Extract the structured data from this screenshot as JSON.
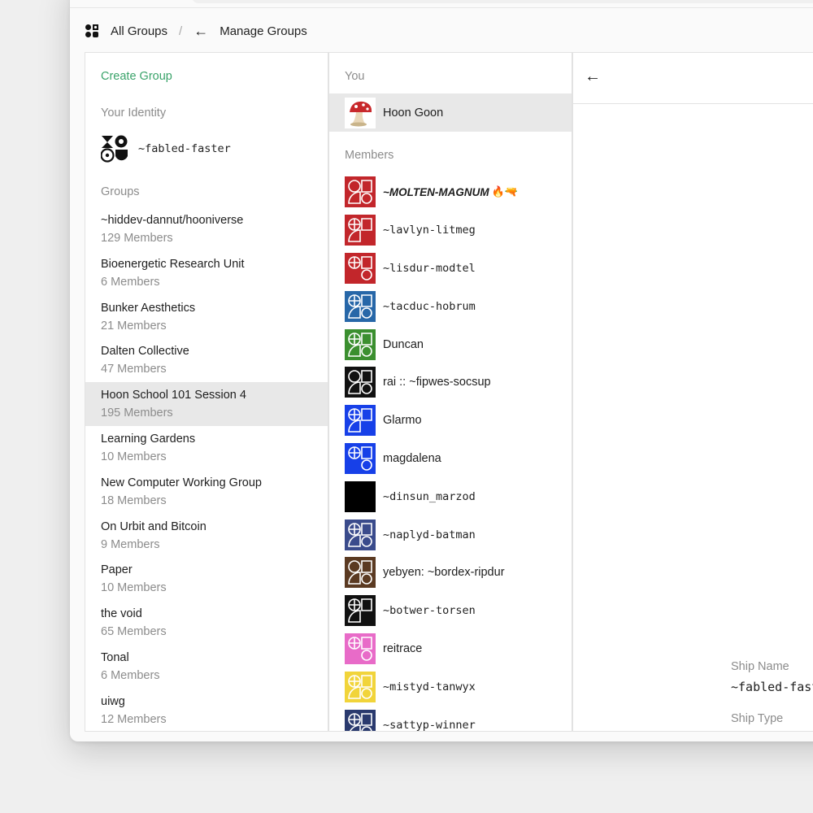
{
  "breadcrumb": {
    "root": "All Groups",
    "separator": "/",
    "back": "←",
    "current": "Manage Groups"
  },
  "sidebar": {
    "create_group": "Create Group",
    "identity_label": "Your Identity",
    "identity_ship": "~fabled-faster",
    "groups_label": "Groups",
    "groups": [
      {
        "name": "~hiddev-dannut/hooniverse",
        "members": "129 Members"
      },
      {
        "name": "Bioenergetic Research Unit",
        "members": "6 Members"
      },
      {
        "name": "Bunker Aesthetics",
        "members": "21 Members"
      },
      {
        "name": "Dalten Collective",
        "members": "47 Members"
      },
      {
        "name": "Hoon School 101 Session 4",
        "members": "195 Members"
      },
      {
        "name": "Learning Gardens",
        "members": "10 Members"
      },
      {
        "name": "New Computer Working Group",
        "members": "18 Members"
      },
      {
        "name": "On Urbit and Bitcoin",
        "members": "9 Members"
      },
      {
        "name": "Paper",
        "members": "10 Members"
      },
      {
        "name": "the void",
        "members": "65 Members"
      },
      {
        "name": "Tonal",
        "members": "6 Members"
      },
      {
        "name": "uiwg",
        "members": "12 Members"
      }
    ]
  },
  "members_panel": {
    "you_label": "You",
    "you_name": "Hoon Goon",
    "members_label": "Members",
    "members": [
      {
        "name": "~MOLTEN-MAGNUM",
        "emoji": "🔥🔫",
        "color": "#c2262b",
        "style": "bold"
      },
      {
        "name": "~lavlyn-litmeg",
        "color": "#c2262b",
        "style": "mono"
      },
      {
        "name": "~lisdur-modtel",
        "color": "#c2262b",
        "style": "mono"
      },
      {
        "name": "~tacduc-hobrum",
        "color": "#2767a8",
        "style": "mono"
      },
      {
        "name": "Duncan",
        "color": "#3b8f2f",
        "style": "sans"
      },
      {
        "name": "rai :: ~fipwes-socsup",
        "color": "#111111",
        "style": "sans"
      },
      {
        "name": "Glarmo",
        "color": "#1740e8",
        "style": "sans"
      },
      {
        "name": "magdalena",
        "color": "#1740e8",
        "style": "sans"
      },
      {
        "name": "~dinsun_marzod",
        "color": "#000000",
        "style": "mono"
      },
      {
        "name": "~naplyd-batman",
        "color": "#3a4b8c",
        "style": "mono"
      },
      {
        "name": "yebyen: ~bordex-ripdur",
        "color": "#5b3a22",
        "style": "sans"
      },
      {
        "name": "~botwer-torsen",
        "color": "#111111",
        "style": "mono"
      },
      {
        "name": "reitrace",
        "color": "#e86bc8",
        "style": "sans"
      },
      {
        "name": "~mistyd-tanwyx",
        "color": "#f1d43a",
        "style": "mono"
      },
      {
        "name": "~sattyp-winner",
        "color": "#2a3a6e",
        "style": "mono"
      }
    ]
  },
  "detail": {
    "back": "←",
    "ship_name_label": "Ship Name",
    "ship_name_value": "~fabled-faster",
    "ship_type_label": "Ship Type"
  }
}
